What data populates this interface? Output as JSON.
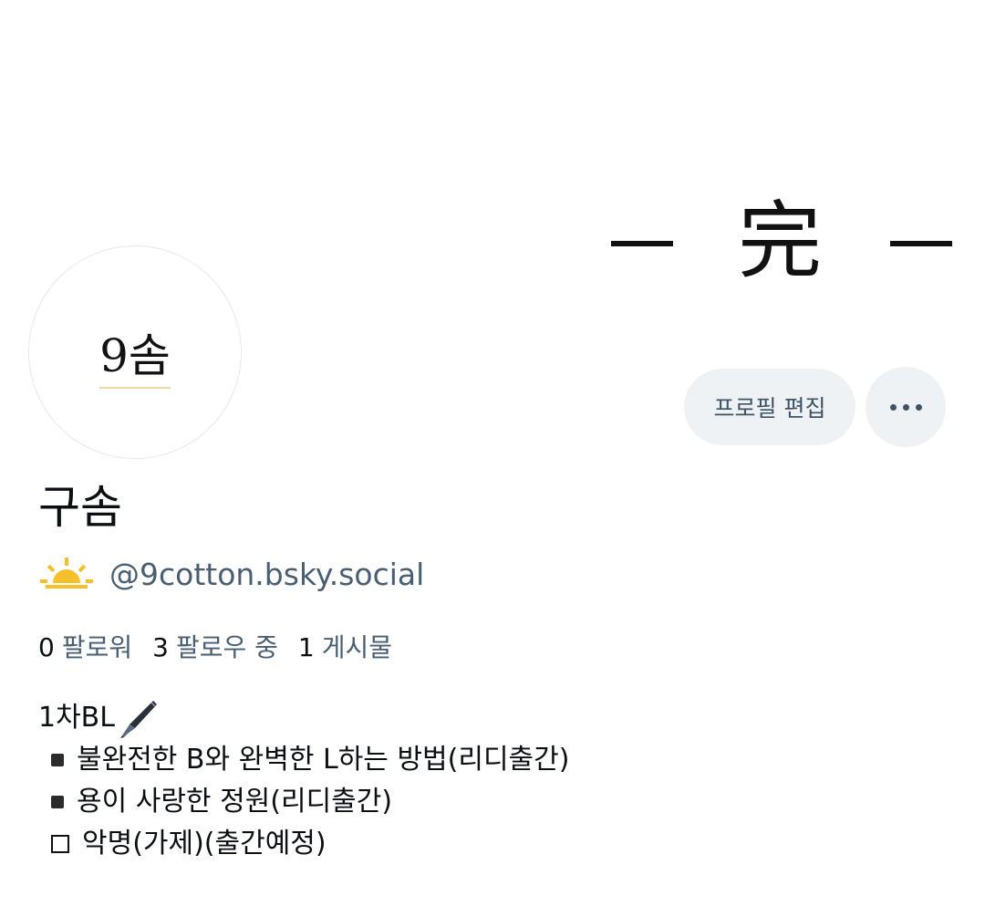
{
  "banner": {
    "text": "完"
  },
  "avatar": {
    "text": "9솜"
  },
  "actions": {
    "edit_profile_label": "프로필 편집",
    "more_label": "…"
  },
  "profile": {
    "display_name": "구솜",
    "handle": "@9cotton.bsky.social",
    "icon": "sunrise-icon"
  },
  "stats": {
    "followers": {
      "count": "0",
      "label": "팔로워"
    },
    "following": {
      "count": "3",
      "label": "팔로우 중"
    },
    "posts": {
      "count": "1",
      "label": "게시물"
    }
  },
  "bio": {
    "line1": "1차BL",
    "line1_icon": "fountain-pen-icon",
    "items": [
      {
        "marker": "filled-square",
        "text": "불완전한 B와 완벽한 L하는 방법(리디출간)"
      },
      {
        "marker": "filled-square",
        "text": "용이 사랑한 정원(리디출간)"
      },
      {
        "marker": "empty-square",
        "text": "악명(가제)(출간예정)"
      }
    ]
  },
  "colors": {
    "text_primary": "#0b0f14",
    "text_secondary": "#4a5e72",
    "button_bg": "#eff2f5",
    "button_text": "#3f5366",
    "sun": "#f6c02b"
  }
}
